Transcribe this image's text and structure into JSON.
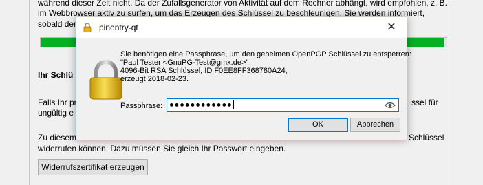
{
  "background": {
    "lines_top": [
      "während dieser Zeit nicht. Da der Zufallsgenerator von Aktivität auf dem Rechner abhängt, wird empfohlen, z. B.",
      "im Webbrowser aktiv zu surfen, um das Erzeugen des Schlüssel zu beschleunigen. Sie werden informiert,",
      "sobald der"
    ],
    "progress_fraction": 0.995,
    "section_heading": "Ihr Schlü",
    "revoke_text_lines": [
      "Falls Ihr pr",
      "ungültig e",
      "ssel für"
    ],
    "lines_bottom": [
      "Zu diesem",
      "widerrufen können. Dazu müssen Sie gleich Ihr Passwort eingeben.",
      "Schlüssel"
    ],
    "revoke_button_label": "Widerrufszertifikat erzeugen"
  },
  "dialog": {
    "title": "pinentry-qt",
    "title_icon": "lock-icon",
    "close_icon": "close-icon",
    "message_lines": [
      "Sie benötigen eine Passphrase, um den geheimen OpenPGP Schlüssel zu entsperren:",
      "\"Paul Tester <GnuPG-Test@gmx.de>\"",
      "4096-Bit RSA Schlüssel, ID F0EE8FF368780A24,",
      "erzeugt 2018-02-23."
    ],
    "passphrase_label": "Passphrase:",
    "passphrase_value": "●●●●●●●●●●●●",
    "show_icon": "eye-icon",
    "ok_label": "OK",
    "cancel_label": "Abbrechen"
  }
}
